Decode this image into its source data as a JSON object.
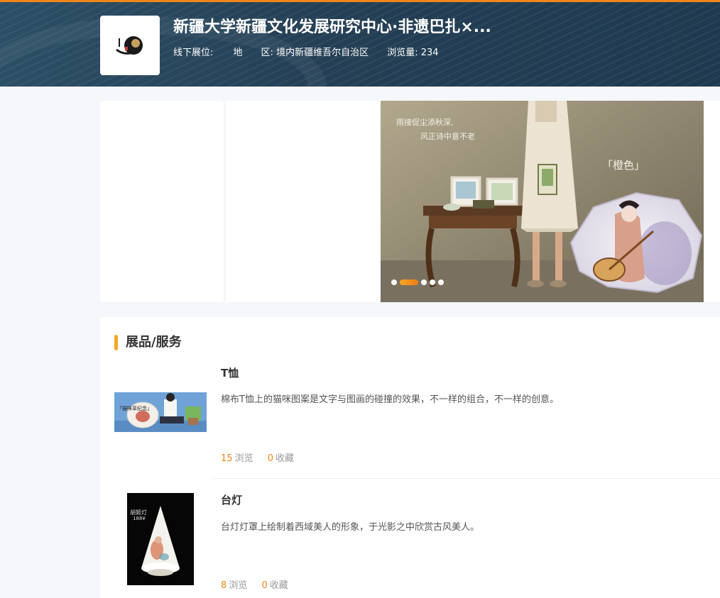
{
  "header": {
    "title": "新疆大学新疆文化发展研究中心·非遗巴扎×...",
    "offline_label": "线下展位:",
    "region_label": "地　　区:",
    "region_value": "境内新疆维吾尔自治区",
    "views_label": "浏览量:",
    "views_value": "234"
  },
  "banner": {
    "poem_line1": "雨接促尘添秋深,",
    "poem_line2": "风正诗中意不老",
    "stamp": "「橙色」",
    "dots_total": 5,
    "active_dot": 1
  },
  "section": {
    "title": "展品/服务"
  },
  "products": [
    {
      "name": "T恤",
      "desc": "棉布T恤上的猫咪图案是文字与图画的碰撞的效果，不一样的组合，不一样的创意。",
      "views": "15",
      "views_label": "浏览",
      "favs": "0",
      "favs_label": "收藏",
      "thumb_caption": "「猫咪草纪念」"
    },
    {
      "name": "台灯",
      "desc": "台灯灯罩上绘制着西域美人的形象，于光影之中欣赏古风美人。",
      "views": "8",
      "views_label": "浏览",
      "favs": "0",
      "favs_label": "收藏",
      "thumb_caption": "胡姬灯",
      "thumb_price": "188¥"
    }
  ],
  "colors": {
    "accent": "#f08519",
    "header_bg": "#243f55",
    "section_marker": "#f5a623"
  }
}
